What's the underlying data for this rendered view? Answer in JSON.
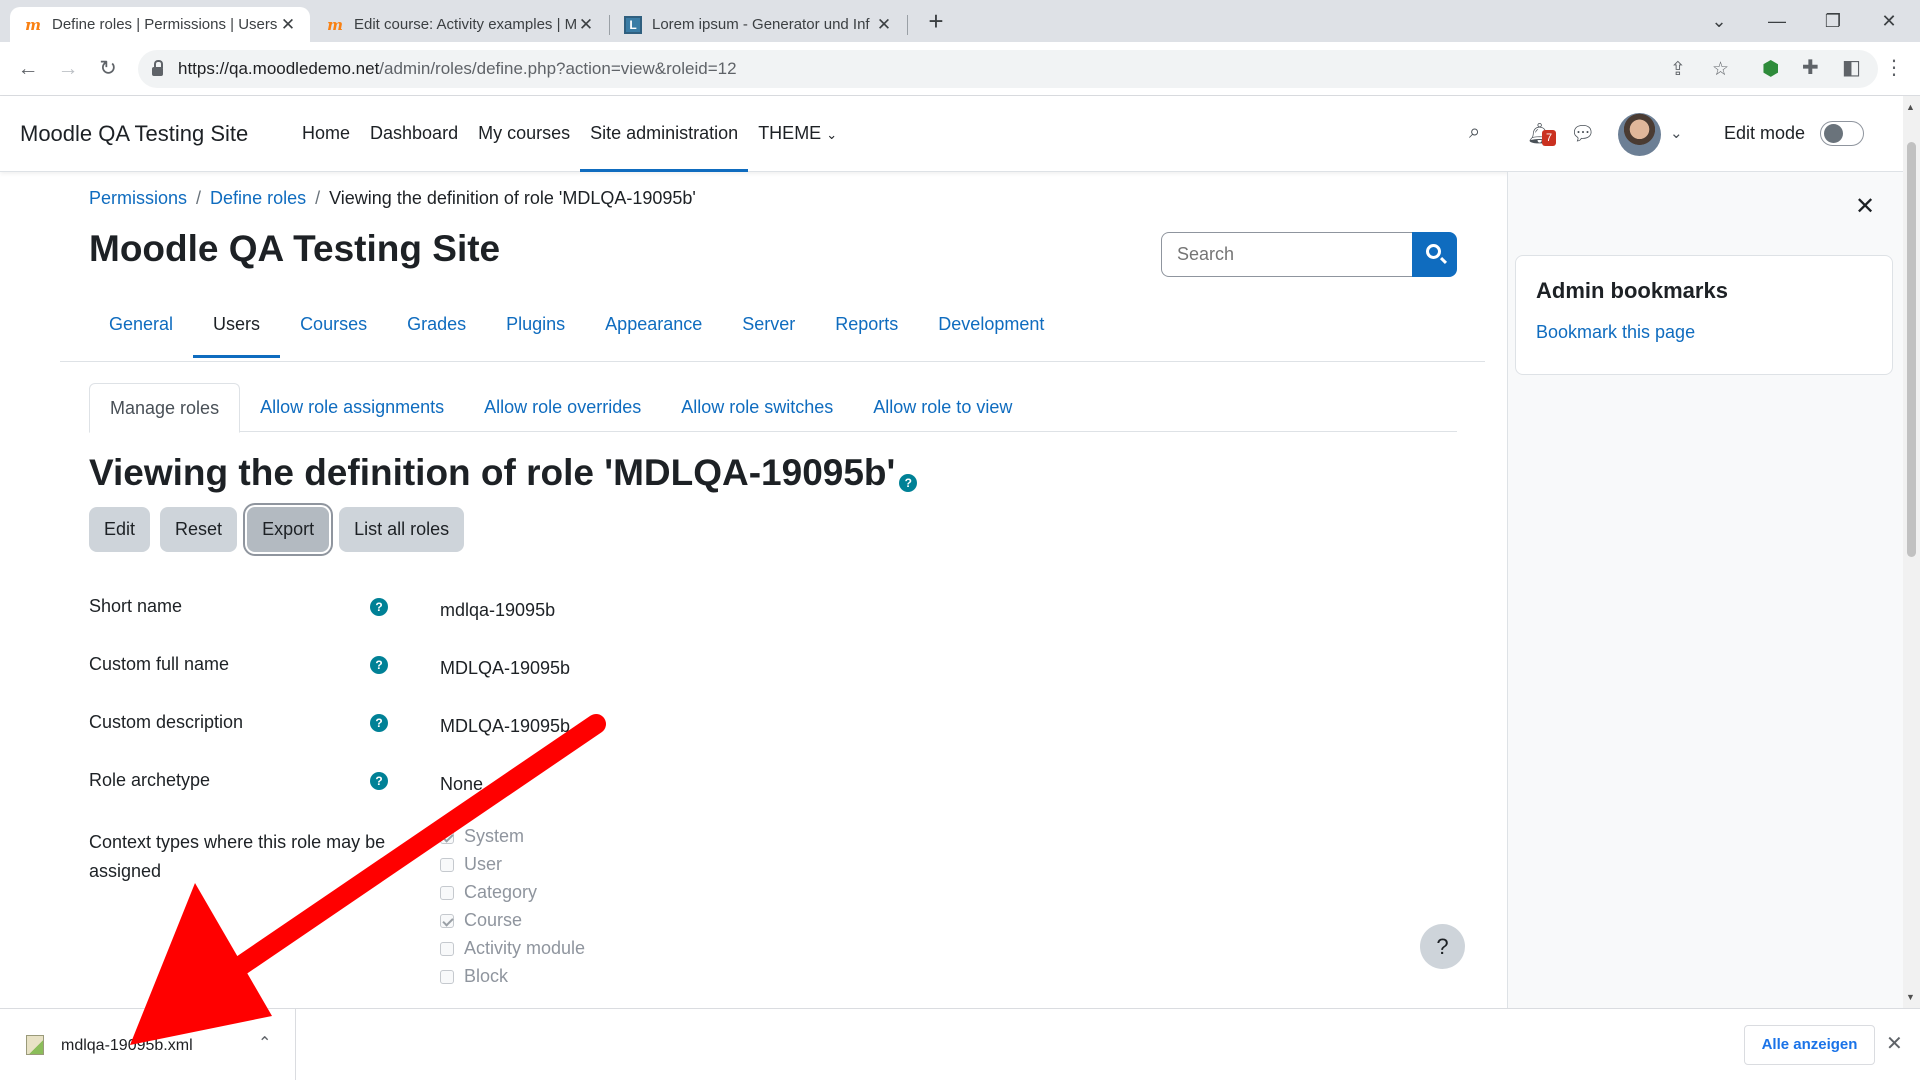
{
  "browser": {
    "tabs": [
      {
        "title": "Define roles | Permissions | Users",
        "favicon": "moodle-icon"
      },
      {
        "title": "Edit course: Activity examples | M",
        "favicon": "moodle-icon"
      },
      {
        "title": "Lorem ipsum - Generator und Inf",
        "favicon": "lorem-icon"
      }
    ],
    "url_host": "https://qa.moodledemo.net",
    "url_path": "/admin/roles/define.php?action=view&roleid=12"
  },
  "navbar": {
    "brand": "Moodle QA Testing Site",
    "items": [
      "Home",
      "Dashboard",
      "My courses",
      "Site administration",
      "THEME"
    ],
    "active": "Site administration",
    "notification_count": "7",
    "edit_mode_label": "Edit mode"
  },
  "breadcrumb": {
    "items": [
      "Permissions",
      "Define roles"
    ],
    "current": "Viewing the definition of role 'MDLQA-19095b'"
  },
  "page": {
    "title": "Moodle QA Testing Site",
    "search_placeholder": "Search",
    "heading": "Viewing the definition of role 'MDLQA-19095b'"
  },
  "secondary_nav": [
    "General",
    "Users",
    "Courses",
    "Grades",
    "Plugins",
    "Appearance",
    "Server",
    "Reports",
    "Development"
  ],
  "tabs": [
    "Manage roles",
    "Allow role assignments",
    "Allow role overrides",
    "Allow role switches",
    "Allow role to view"
  ],
  "buttons": [
    "Edit",
    "Reset",
    "Export",
    "List all roles"
  ],
  "fields": [
    {
      "label": "Short name",
      "value": "mdlqa-19095b"
    },
    {
      "label": "Custom full name",
      "value": "MDLQA-19095b"
    },
    {
      "label": "Custom description",
      "value": "MDLQA-19095b"
    },
    {
      "label": "Role archetype",
      "value": "None"
    }
  ],
  "context": {
    "label": "Context types where this role may be assigned",
    "options": [
      {
        "name": "System",
        "checked": true
      },
      {
        "name": "User",
        "checked": false
      },
      {
        "name": "Category",
        "checked": false
      },
      {
        "name": "Course",
        "checked": true
      },
      {
        "name": "Activity module",
        "checked": false
      },
      {
        "name": "Block",
        "checked": false
      }
    ]
  },
  "drawer": {
    "title": "Admin bookmarks",
    "link": "Bookmark this page"
  },
  "download": {
    "filename": "mdlqa-19095b.xml",
    "show_all": "Alle anzeigen"
  },
  "colors": {
    "accent": "#0f6cbf",
    "help": "#008196",
    "annotation": "#ff0000"
  }
}
